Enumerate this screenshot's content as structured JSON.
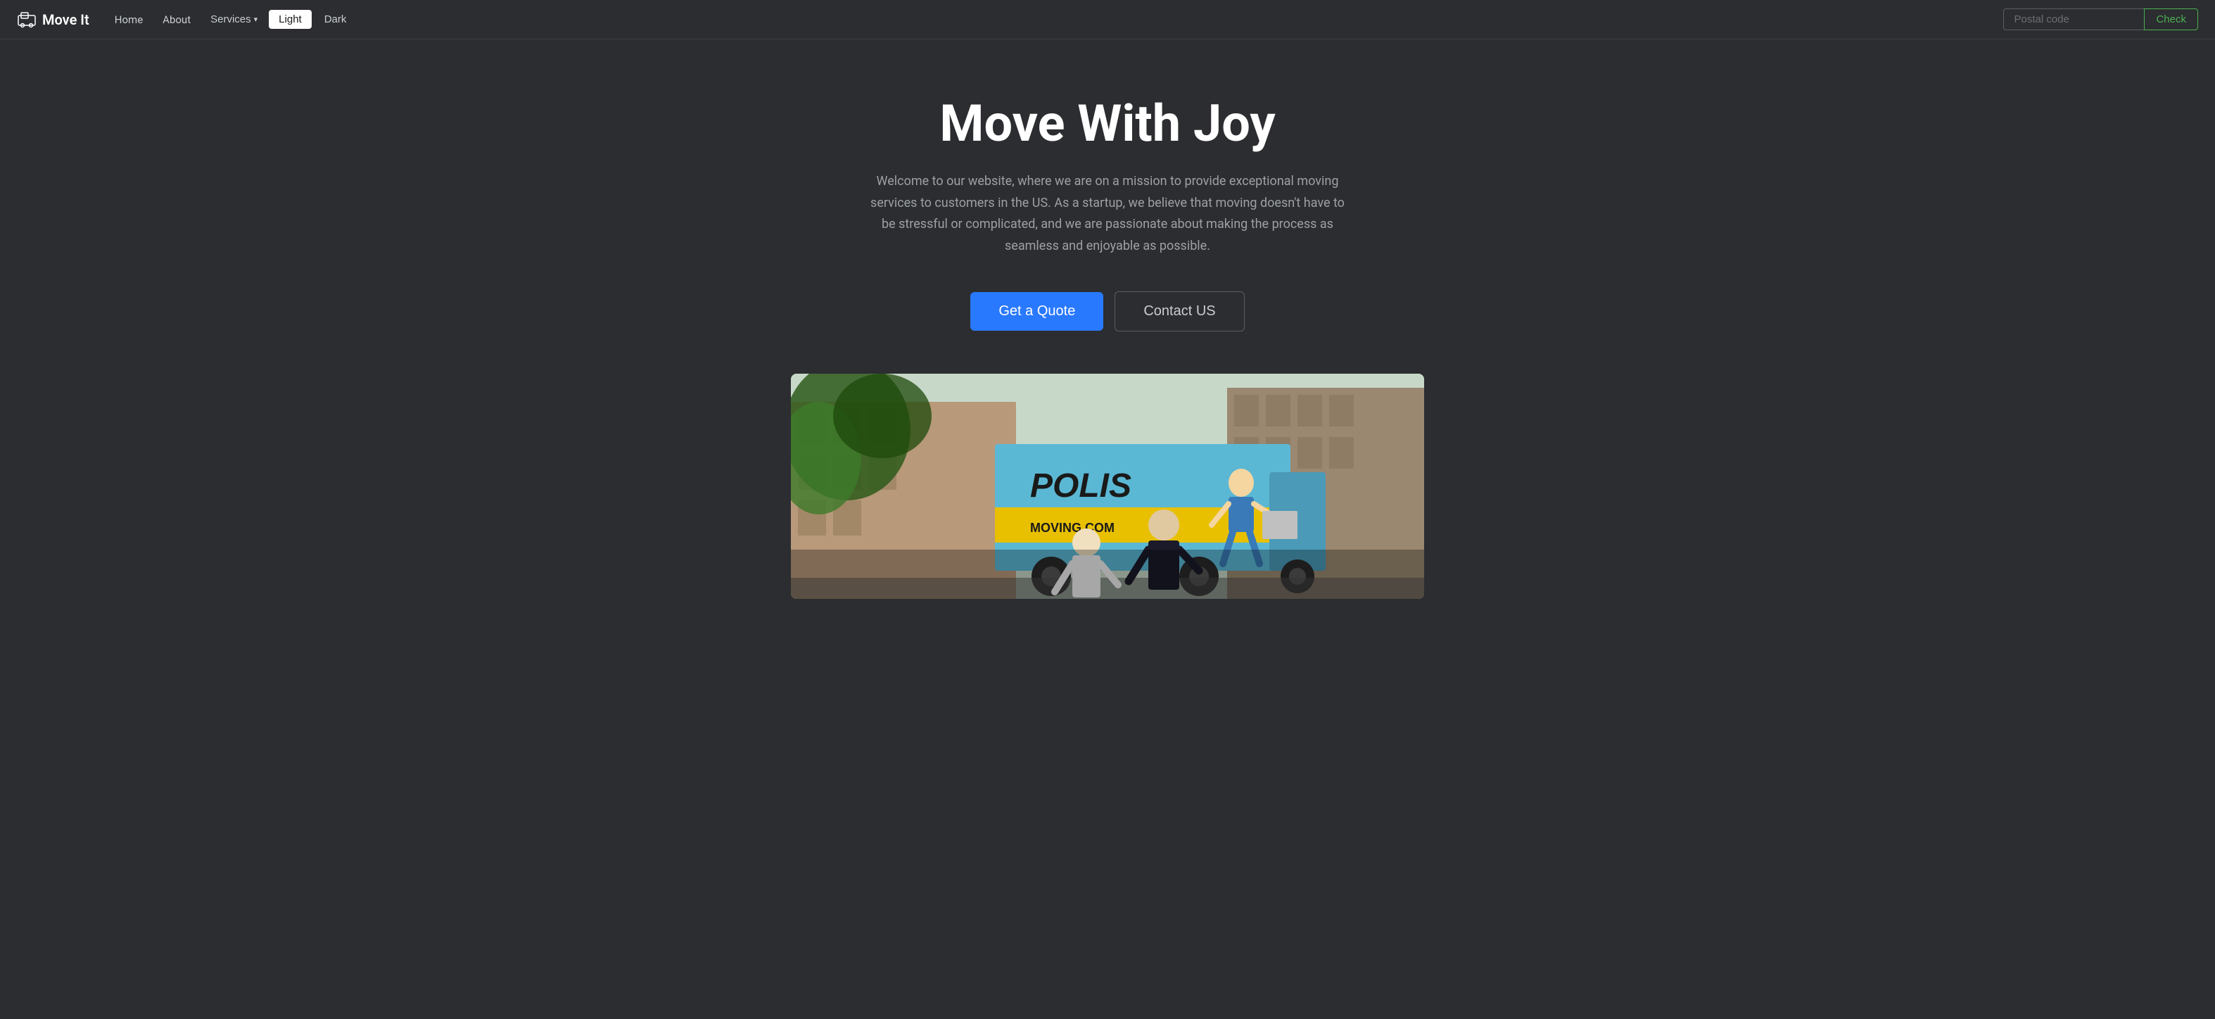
{
  "brand": {
    "name": "Move It",
    "icon_label": "move-it-icon"
  },
  "navbar": {
    "home_label": "Home",
    "about_label": "About",
    "services_label": "Services",
    "light_label": "Light",
    "dark_label": "Dark",
    "postal_placeholder": "Postal code",
    "check_label": "Check"
  },
  "hero": {
    "title": "Move With Joy",
    "description": "Welcome to our website, where we are on a mission to provide exceptional moving services to customers in the US. As a startup, we believe that moving doesn't have to be stressful or complicated, and we are passionate about making the process as seamless and enjoyable as possible.",
    "get_quote_label": "Get a Quote",
    "contact_us_label": "Contact US"
  },
  "image": {
    "truck_text": "POLIS",
    "truck_subtext": "MOVING.COM",
    "alt": "Moving truck scene with workers"
  },
  "colors": {
    "bg": "#2b2d30",
    "accent_blue": "#2979ff",
    "accent_green": "#4caf50",
    "text_muted": "#9da0a4",
    "border": "#5a5d61"
  }
}
